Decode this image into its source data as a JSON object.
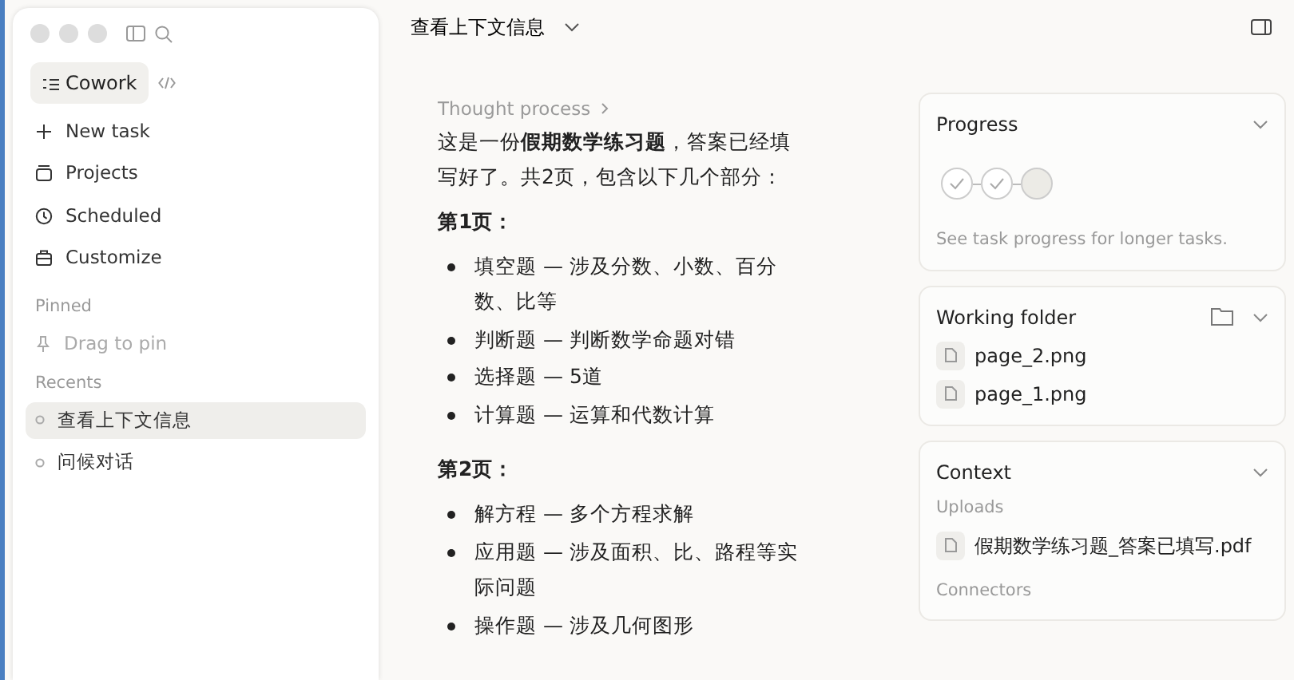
{
  "sidebar": {
    "mode": "Cowork",
    "nav": [
      "New task",
      "Projects",
      "Scheduled",
      "Customize"
    ],
    "pinned": {
      "heading": "Pinned",
      "hint": "Drag to pin"
    },
    "recents": {
      "heading": "Recents",
      "items": [
        {
          "label": "查看上下文信息",
          "selected": true
        },
        {
          "label": "问候对话",
          "selected": false
        }
      ]
    }
  },
  "header": {
    "title": "查看上下文信息"
  },
  "chat": {
    "thought": "Thought process",
    "intro": "这是一份**假期数学练习题**，答案已经填写好了。共2页，包含以下几个部分：",
    "sections": [
      {
        "heading": "第1页：",
        "items": [
          "填空题 — 涉及分数、小数、百分数、比等",
          "判断题 — 判断数学命题对错",
          "选择题 — 5道",
          "计算题 — 运算和代数计算"
        ]
      },
      {
        "heading": "第2页：",
        "items": [
          "解方程 — 多个方程求解",
          "应用题 — 涉及面积、比、路程等实际问题",
          "操作题 — 涉及几何图形"
        ]
      }
    ]
  },
  "panels": {
    "progress": {
      "title": "Progress",
      "steps": [
        {
          "done": true
        },
        {
          "done": true
        },
        {
          "done": false
        }
      ],
      "note": "See task progress for longer tasks."
    },
    "folder": {
      "title": "Working folder",
      "files": [
        "page_2.png",
        "page_1.png"
      ]
    },
    "context": {
      "title": "Context",
      "uploads_heading": "Uploads",
      "uploads": [
        "假期数学练习题_答案已填写.pdf"
      ],
      "connectors_heading": "Connectors"
    }
  }
}
